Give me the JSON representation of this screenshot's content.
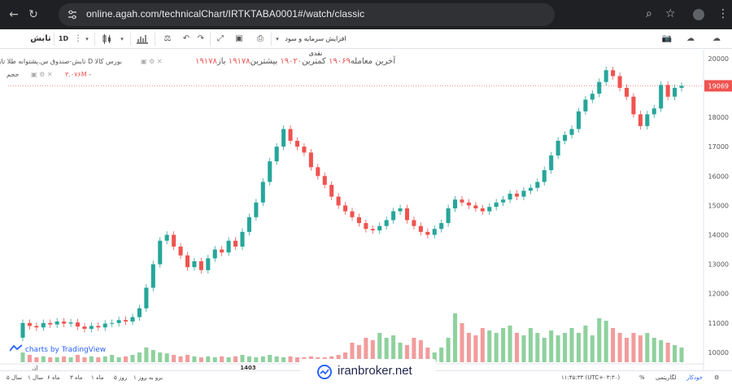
{
  "browser": {
    "url": "online.agah.com/technicalChart/IRTKTABA0001#/watch/classic"
  },
  "toolbar": {
    "symbol": "تابش",
    "interval": "1D",
    "indicator_label": "افزایش سرمایه و سود نقدی"
  },
  "legend": {
    "title": "بورس کالا D تابش-صندوق س.پشتوانه طلا تابان تمدن",
    "last_trade_label": "آخرین معامله",
    "last_trade_value": "۱۹۰۶۹",
    "low_label": "کمترین",
    "low_value": "۱۹۰۲۰",
    "high_label": "بیشترین",
    "high_value": "۱۹۱۷۸",
    "open_label": "باز",
    "open_value": "۱۹۱۷۸",
    "volume_label": "حجم",
    "volume_value": "۳.۰۷۶M"
  },
  "price_axis": {
    "ticks": [
      "20000",
      "19000",
      "18000",
      "17000",
      "16000",
      "15000",
      "14000",
      "13000",
      "12000",
      "11000",
      "10000"
    ],
    "last_price_badge": "19069"
  },
  "time_axis": {
    "labels": [
      "آذر",
      "1403"
    ]
  },
  "bottom_bar": {
    "periods": [
      "۵ سال",
      "۱ سال",
      "۶ ماه",
      "۳ ماه",
      "۱ ماه",
      "۵ روز",
      "۱ روز",
      "برو به ..."
    ],
    "time": "۱۱:۴۵:۳۳ (UTC+۰۳:۳۰)",
    "percent_label": "%",
    "log_label": "لگاریتمی",
    "auto_label": "خودکار"
  },
  "branding": {
    "tradingview": "charts by TradingView",
    "watermark": "iranbroker.net"
  },
  "colors": {
    "up": "#26a69a",
    "down": "#ef5350",
    "volume_up": "#8fd19e",
    "volume_down": "#f29c9c"
  },
  "chart_data": {
    "type": "candlestick",
    "ylim": [
      9500,
      20300
    ],
    "series": [
      {
        "name": "close",
        "values": [
          11000,
          10900,
          10850,
          11000,
          10950,
          11050,
          10980,
          11020,
          10880,
          10800,
          10900,
          10850,
          10980,
          11000,
          11100,
          11050,
          11200,
          11500,
          12200,
          13000,
          13800,
          14000,
          13600,
          13300,
          12900,
          13100,
          12800,
          13200,
          13500,
          13400,
          13800,
          13600,
          14100,
          14600,
          15100,
          15800,
          16500,
          17000,
          17600,
          17200,
          17000,
          16800,
          16300,
          16000,
          15700,
          15300,
          15000,
          14800,
          14600,
          14400,
          14200,
          14150,
          14300,
          14500,
          14800,
          14900,
          14500,
          14300,
          14100,
          14000,
          14200,
          14400,
          14900,
          15200,
          15100,
          15000,
          14900,
          14800,
          14950,
          15100,
          15200,
          15400,
          15300,
          15500,
          15600,
          15800,
          16200,
          16700,
          17200,
          17400,
          17600,
          18200,
          18600,
          18800,
          19200,
          19600,
          19400,
          19000,
          18700,
          18100,
          17700,
          18100,
          18300,
          19100,
          18700,
          19000,
          19069
        ]
      },
      {
        "name": "volume",
        "values": [
          0.2,
          0.15,
          0.1,
          0.12,
          0.1,
          0.1,
          0.12,
          0.1,
          0.15,
          0.1,
          0.12,
          0.1,
          0.12,
          0.15,
          0.1,
          0.12,
          0.15,
          0.2,
          0.3,
          0.25,
          0.2,
          0.18,
          0.15,
          0.12,
          0.15,
          0.12,
          0.1,
          0.12,
          0.1,
          0.12,
          0.1,
          0.12,
          0.15,
          0.12,
          0.1,
          0.12,
          0.15,
          0.12,
          0.1,
          0.12,
          0.1,
          0.1,
          0.12,
          0.1,
          0.1,
          0.12,
          0.15,
          0.2,
          0.4,
          0.35,
          0.5,
          0.45,
          0.6,
          0.5,
          0.55,
          0.4,
          0.35,
          0.5,
          0.45,
          0.3,
          0.2,
          0.3,
          0.5,
          1.0,
          0.8,
          0.6,
          0.55,
          0.7,
          0.65,
          0.6,
          0.7,
          0.75,
          0.6,
          0.55,
          0.7,
          0.6,
          0.5,
          0.65,
          0.55,
          0.6,
          0.7,
          0.6,
          0.75,
          0.55,
          0.9,
          0.85,
          0.7,
          0.6,
          0.5,
          0.6,
          0.55,
          0.6,
          0.5,
          0.45,
          0.4,
          0.35,
          0.3
        ]
      }
    ]
  }
}
